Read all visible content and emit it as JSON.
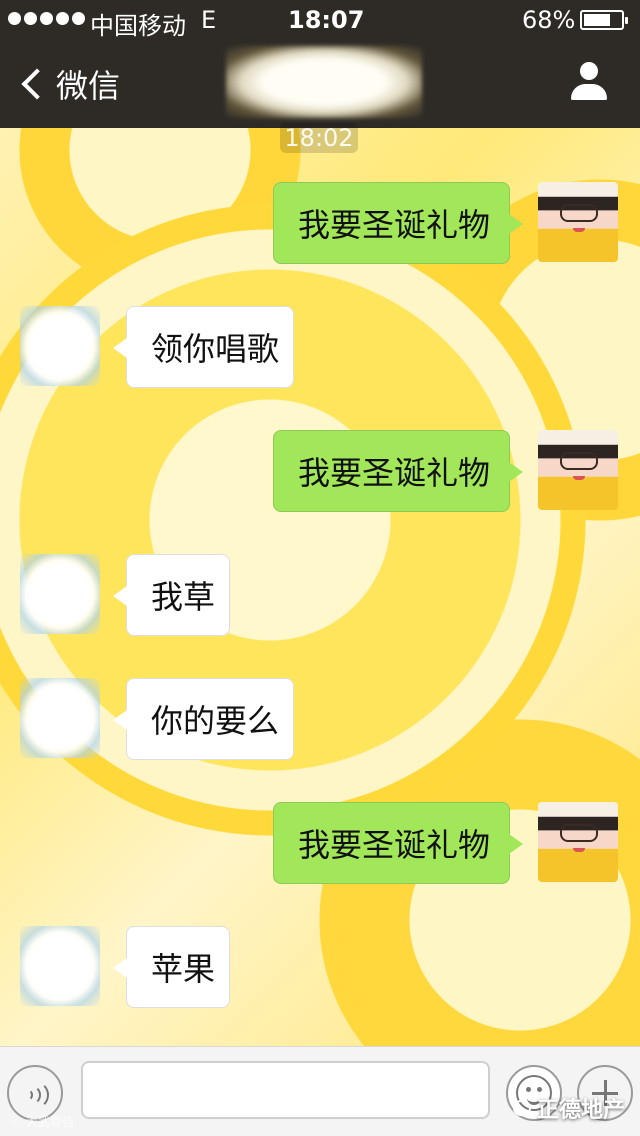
{
  "status_bar": {
    "carrier": "中国移动",
    "network": "E",
    "time": "18:07",
    "battery_percent": "68%"
  },
  "nav_bar": {
    "back_label": "微信",
    "icons": {
      "back": "chevron-left-icon",
      "profile": "person-icon"
    }
  },
  "timestamp": "18:02",
  "messages": [
    {
      "side": "right",
      "text": "我要圣诞礼物"
    },
    {
      "side": "left",
      "text": "领你唱歌"
    },
    {
      "side": "right",
      "text": "我要圣诞礼物"
    },
    {
      "side": "left",
      "text": "我草"
    },
    {
      "side": "left",
      "text": "你的要么"
    },
    {
      "side": "right",
      "text": "我要圣诞礼物"
    },
    {
      "side": "left",
      "text": "苹果"
    }
  ],
  "input_bar": {
    "placeholder": "",
    "icons": {
      "voice": "voice-icon",
      "emoji": "emoji-icon",
      "plus": "plus-icon"
    }
  },
  "watermarks": {
    "left": "ⓒ 大武写信",
    "right": "正德地产"
  },
  "colors": {
    "header": "#2e2b27",
    "outgoing_bubble": "#a2e759",
    "incoming_bubble": "#ffffff"
  }
}
